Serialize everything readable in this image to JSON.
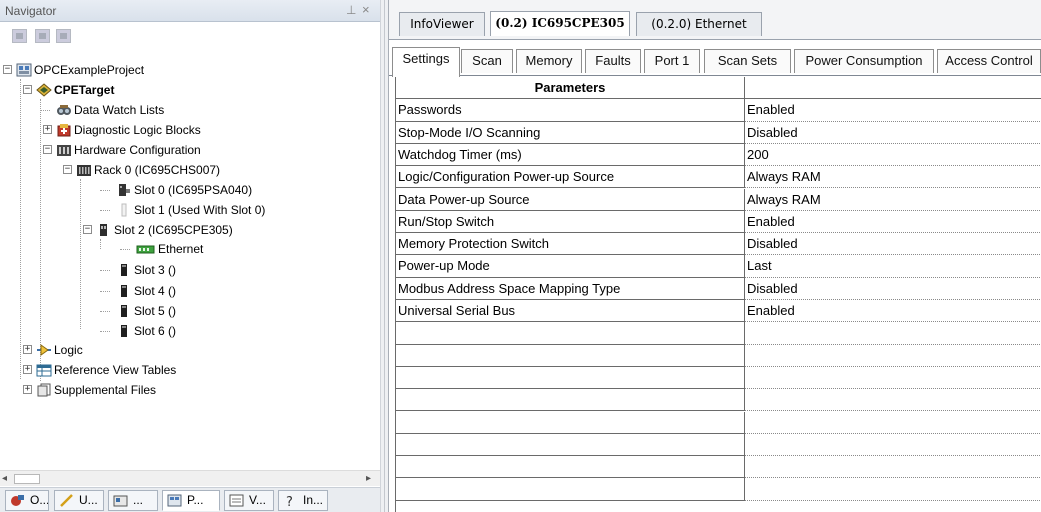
{
  "navigator": {
    "title": "Navigator",
    "pin_glyph": "⊥",
    "close_glyph": "×",
    "toolbar": [
      "grid-view-icon",
      "list-view-icon",
      "properties-view-icon"
    ],
    "tree": [
      {
        "label": "OPCExampleProject",
        "icon": "project-icon",
        "expander": "−"
      },
      {
        "label": "CPETarget",
        "icon": "target-icon",
        "expander": "−",
        "bold": true
      },
      {
        "label": "Data Watch Lists",
        "icon": "watch-list-icon",
        "expander": ""
      },
      {
        "label": "Diagnostic Logic Blocks",
        "icon": "diagnostic-block-icon",
        "expander": "+"
      },
      {
        "label": "Hardware Configuration",
        "icon": "hardware-icon",
        "expander": "−"
      },
      {
        "label": "Rack 0 (IC695CHS007)",
        "icon": "rack-icon",
        "expander": "−"
      },
      {
        "label": "Slot 0 (IC695PSA040)",
        "icon": "power-supply-icon",
        "expander": ""
      },
      {
        "label": "Slot 1 (Used With Slot 0)",
        "icon": "empty-slot-icon",
        "expander": ""
      },
      {
        "label": "Slot 2 (IC695CPE305)",
        "icon": "cpu-module-icon",
        "expander": "−"
      },
      {
        "label": "Ethernet",
        "icon": "ethernet-icon",
        "expander": ""
      },
      {
        "label": "Slot 3 ()",
        "icon": "slot-icon",
        "expander": ""
      },
      {
        "label": "Slot 4 ()",
        "icon": "slot-icon",
        "expander": ""
      },
      {
        "label": "Slot 5 ()",
        "icon": "slot-icon",
        "expander": ""
      },
      {
        "label": "Slot 6 ()",
        "icon": "slot-icon",
        "expander": ""
      },
      {
        "label": "Logic",
        "icon": "logic-icon",
        "expander": "+"
      },
      {
        "label": "Reference View Tables",
        "icon": "reference-table-icon",
        "expander": "+"
      },
      {
        "label": "Supplemental Files",
        "icon": "supplemental-files-icon",
        "expander": "+"
      }
    ],
    "bottom_tabs": [
      {
        "label": "O...",
        "icon": "options-icon"
      },
      {
        "label": "U...",
        "icon": "utilities-icon"
      },
      {
        "label": "...",
        "icon": "manager-icon"
      },
      {
        "label": "P...",
        "icon": "project-tab-icon",
        "active": true
      },
      {
        "label": "V...",
        "icon": "variables-icon"
      },
      {
        "label": "In...",
        "icon": "info-icon"
      }
    ]
  },
  "document_tabs": [
    {
      "label": "InfoViewer",
      "active": false
    },
    {
      "label": "(0.2) IC695CPE305",
      "active": true
    },
    {
      "label": "(0.2.0) Ethernet",
      "active": false
    }
  ],
  "settings_tabs": [
    {
      "label": "Settings",
      "active": true
    },
    {
      "label": "Scan"
    },
    {
      "label": "Memory"
    },
    {
      "label": "Faults"
    },
    {
      "label": "Port 1"
    },
    {
      "label": "Scan Sets"
    },
    {
      "label": "Power Consumption"
    },
    {
      "label": "Access Control"
    }
  ],
  "grid": {
    "header": [
      "Parameters",
      ""
    ],
    "rows": [
      [
        "Passwords",
        "Enabled"
      ],
      [
        "Stop-Mode I/O Scanning",
        "Disabled"
      ],
      [
        "Watchdog Timer (ms)",
        "200"
      ],
      [
        "Logic/Configuration Power-up Source",
        "Always RAM"
      ],
      [
        "Data Power-up Source",
        "Always RAM"
      ],
      [
        "Run/Stop Switch",
        "Enabled"
      ],
      [
        "Memory Protection Switch",
        "Disabled"
      ],
      [
        "Power-up Mode",
        "Last"
      ],
      [
        "Modbus Address Space Mapping Type",
        "Disabled"
      ],
      [
        "Universal Serial Bus",
        "Enabled"
      ],
      [
        "",
        ""
      ],
      [
        "",
        ""
      ],
      [
        "",
        ""
      ],
      [
        "",
        ""
      ],
      [
        "",
        ""
      ],
      [
        "",
        ""
      ],
      [
        "",
        ""
      ],
      [
        "",
        ""
      ]
    ]
  }
}
